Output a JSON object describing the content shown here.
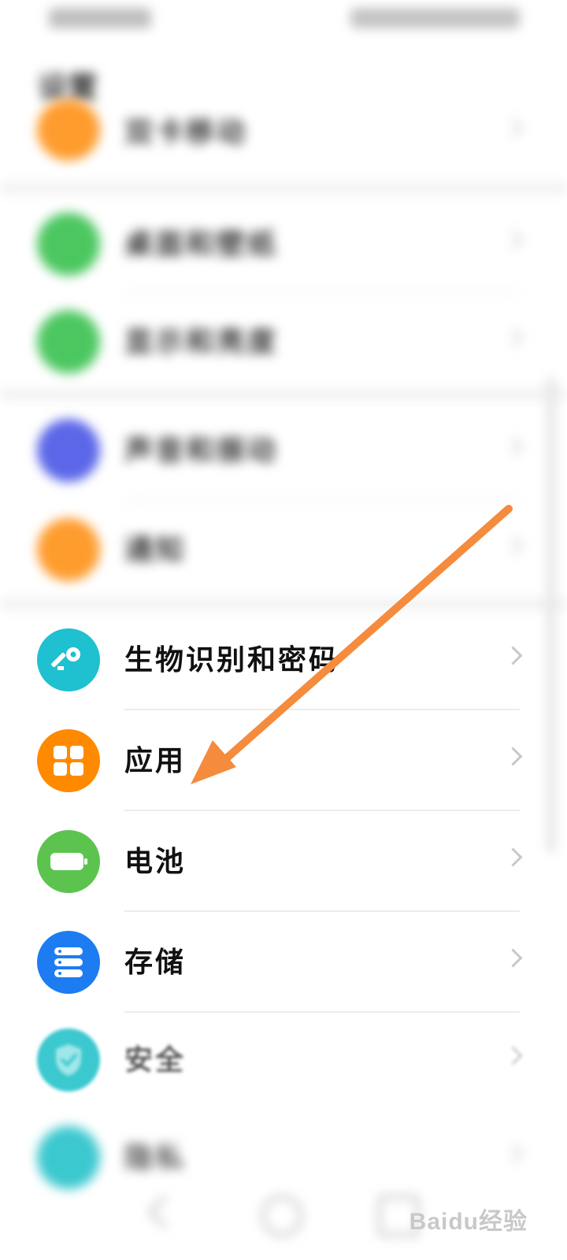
{
  "page": {
    "title": "设置"
  },
  "settings": {
    "items": [
      {
        "id": "item-1",
        "label": "双卡移动",
        "color": "#ff9c2e",
        "icon": "orange-icon"
      },
      {
        "id": "item-2",
        "label": "桌面和壁纸",
        "color": "#4cc760",
        "icon": "wallpaper-icon"
      },
      {
        "id": "item-3",
        "label": "显示和亮度",
        "color": "#4cc760",
        "icon": "display-icon"
      },
      {
        "id": "item-4",
        "label": "声音和振动",
        "color": "#5b67e8",
        "icon": "sound-icon"
      },
      {
        "id": "item-5",
        "label": "通知",
        "color": "#ff9c2e",
        "icon": "notification-icon"
      },
      {
        "id": "biometrics",
        "label": "生物识别和密码",
        "color": "#1fc0cf",
        "icon": "key-icon"
      },
      {
        "id": "apps",
        "label": "应用",
        "color": "#ff8a00",
        "icon": "apps-grid-icon"
      },
      {
        "id": "battery",
        "label": "电池",
        "color": "#5cc44e",
        "icon": "battery-icon"
      },
      {
        "id": "storage",
        "label": "存储",
        "color": "#1d7cf2",
        "icon": "storage-icon"
      },
      {
        "id": "security",
        "label": "安全",
        "color": "#3cc8cf",
        "icon": "shield-icon"
      },
      {
        "id": "privacy",
        "label": "隐私",
        "color": "#3cc8cf",
        "icon": "privacy-icon"
      }
    ]
  },
  "watermark": {
    "text": "Baidu经验"
  },
  "annotation": {
    "color": "#f58b3c",
    "points_to": "应用"
  }
}
